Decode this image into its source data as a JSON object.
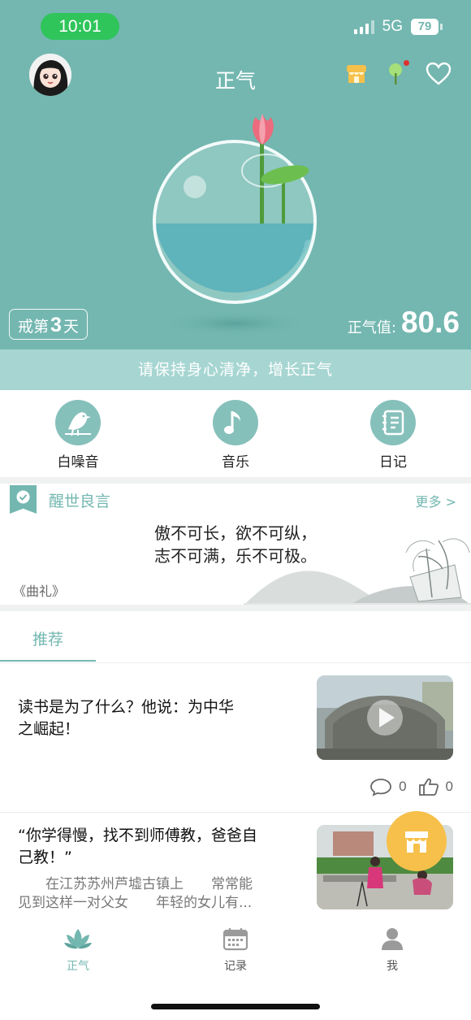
{
  "status_bar": {
    "time": "10:01",
    "network": "5G",
    "battery": "79"
  },
  "header": {
    "title": "正气"
  },
  "hero": {
    "streak_prefix": "戒第",
    "streak_days": "3",
    "streak_suffix": "天",
    "score_label": "正气值:",
    "score_value": "80.6"
  },
  "slogan": "请保持身心清净，增长正气",
  "features": [
    {
      "label": "白噪音",
      "icon": "bird-icon"
    },
    {
      "label": "音乐",
      "icon": "music-note-icon"
    },
    {
      "label": "日记",
      "icon": "notebook-icon"
    }
  ],
  "quote": {
    "section_title": "醒世良言",
    "more": "更多 >",
    "lines": [
      "傲不可长，欲不可纵，",
      "志不可满，乐不可极。"
    ],
    "source": "《曲礼》"
  },
  "tabs": {
    "active": "推荐"
  },
  "articles": [
    {
      "title_lines": [
        "读书是为了什么？他说：为中华",
        "之崛起！"
      ],
      "comments": "0",
      "likes": "0",
      "has_video": true
    },
    {
      "title_lines": [
        "“你学得慢，找不到师傅教，爸爸自",
        "己教！”"
      ],
      "desc_lines": [
        "　　在江苏苏州芦墟古镇上　　常常能",
        "见到这样一对父女　　年轻的女儿有..."
      ]
    }
  ],
  "bottom_nav": [
    {
      "label": "正气",
      "icon": "lotus-icon",
      "active": true
    },
    {
      "label": "记录",
      "icon": "calendar-icon",
      "active": false
    },
    {
      "label": "我",
      "icon": "person-icon",
      "active": false
    }
  ],
  "colors": {
    "primary": "#73b7b0",
    "slogan_bg": "#a7d6d2",
    "fab": "#f6c04a",
    "status_green": "#2fc55a"
  }
}
